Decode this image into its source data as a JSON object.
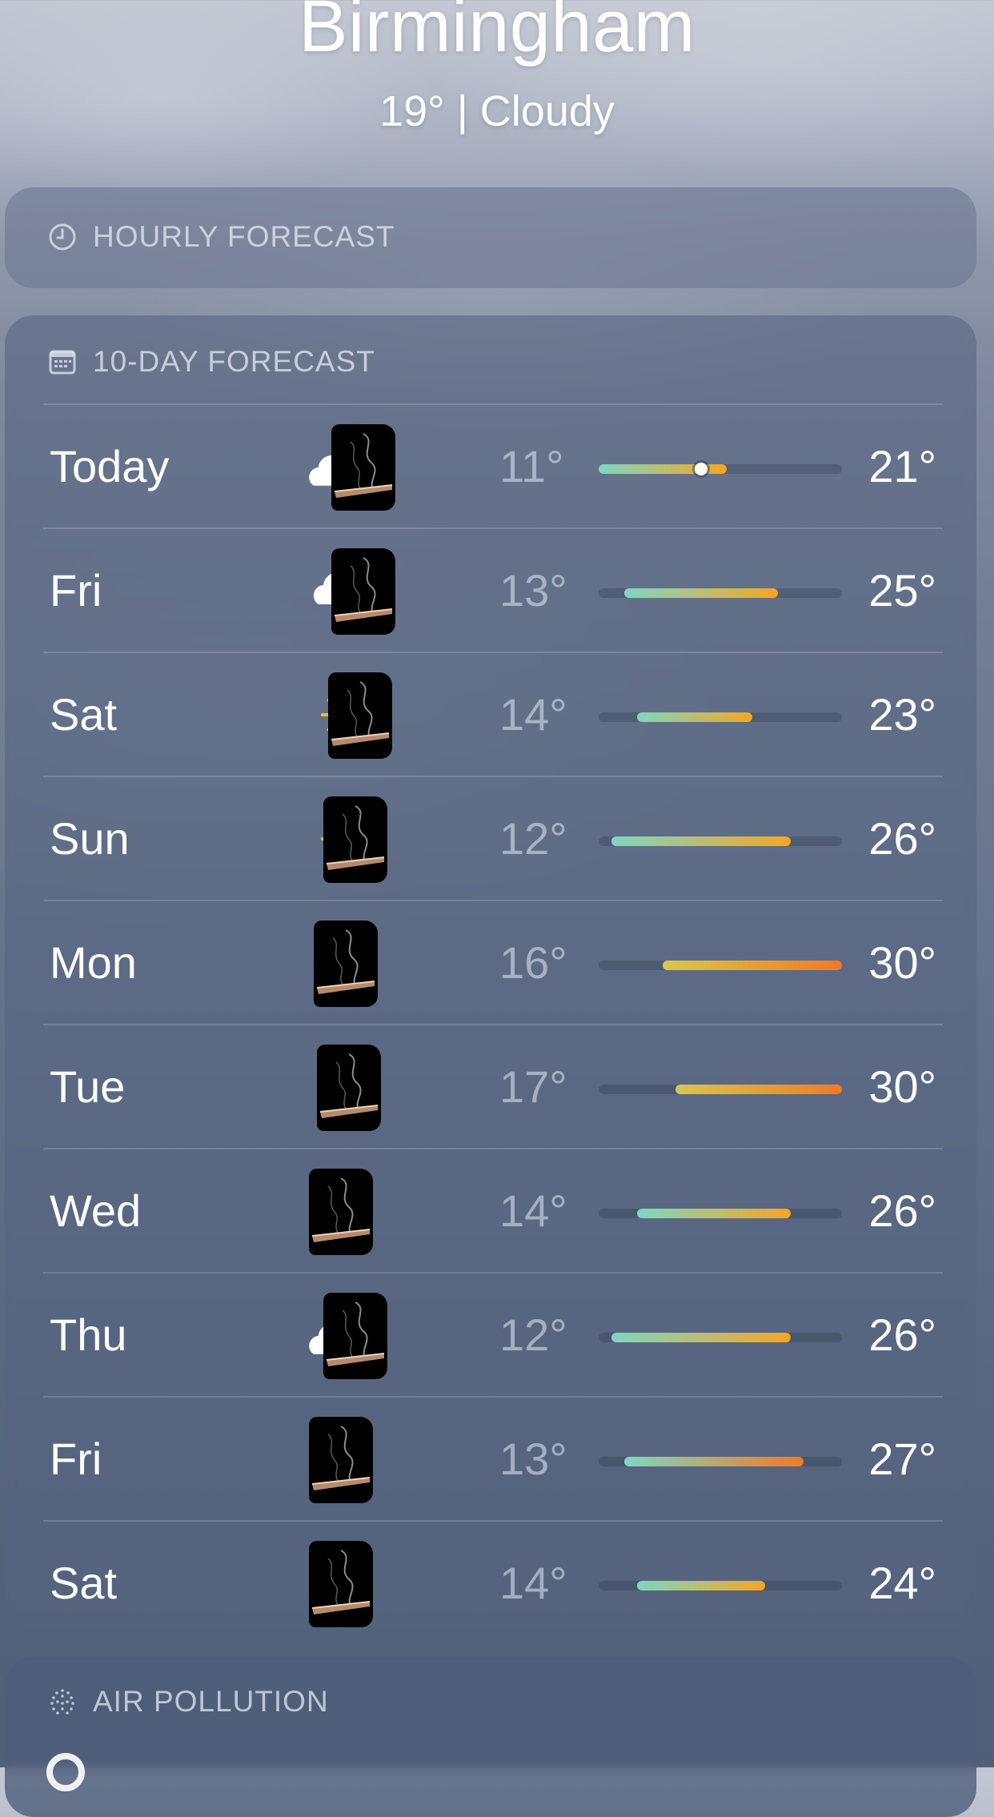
{
  "location": {
    "city": "Birmingham",
    "summary": "19° | Cloudy"
  },
  "hourly": {
    "label": "HOURLY FORECAST",
    "icon": "clock-icon"
  },
  "ten_day": {
    "label": "10-DAY FORECAST",
    "icon": "calendar-icon",
    "range_min": 11,
    "range_max": 30,
    "current_temp": 19,
    "days": [
      {
        "day": "Today",
        "icon": "partly-cloudy-icon",
        "low": "11°",
        "high": "21°",
        "low_val": 11,
        "high_val": 21,
        "show_now": true
      },
      {
        "day": "Fri",
        "icon": "cloud-icon",
        "low": "13°",
        "high": "25°",
        "low_val": 13,
        "high_val": 25
      },
      {
        "day": "Sat",
        "icon": "sun-icon",
        "low": "14°",
        "high": "23°",
        "low_val": 14,
        "high_val": 23
      },
      {
        "day": "Sun",
        "icon": "sun-icon",
        "low": "12°",
        "high": "26°",
        "low_val": 12,
        "high_val": 26
      },
      {
        "day": "Mon",
        "icon": "sun-icon",
        "low": "16°",
        "high": "30°",
        "low_val": 16,
        "high_val": 30
      },
      {
        "day": "Tue",
        "icon": "sun-icon",
        "low": "17°",
        "high": "30°",
        "low_val": 17,
        "high_val": 30
      },
      {
        "day": "Wed",
        "icon": "sun-icon",
        "low": "14°",
        "high": "26°",
        "low_val": 14,
        "high_val": 26
      },
      {
        "day": "Thu",
        "icon": "partly-cloudy-icon",
        "low": "12°",
        "high": "26°",
        "low_val": 12,
        "high_val": 26
      },
      {
        "day": "Fri",
        "icon": "sun-icon",
        "low": "13°",
        "high": "27°",
        "low_val": 13,
        "high_val": 27
      },
      {
        "day": "Sat",
        "icon": "sun-icon",
        "low": "14°",
        "high": "24°",
        "low_val": 14,
        "high_val": 24
      }
    ]
  },
  "air": {
    "label": "AIR POLLUTION",
    "icon": "air-quality-icon"
  },
  "colors": {
    "sun": "#ffc21a",
    "cool": "#7fd6c3",
    "mild": "#d7c84c",
    "warm": "#f5a623",
    "hot": "#f07a24"
  }
}
